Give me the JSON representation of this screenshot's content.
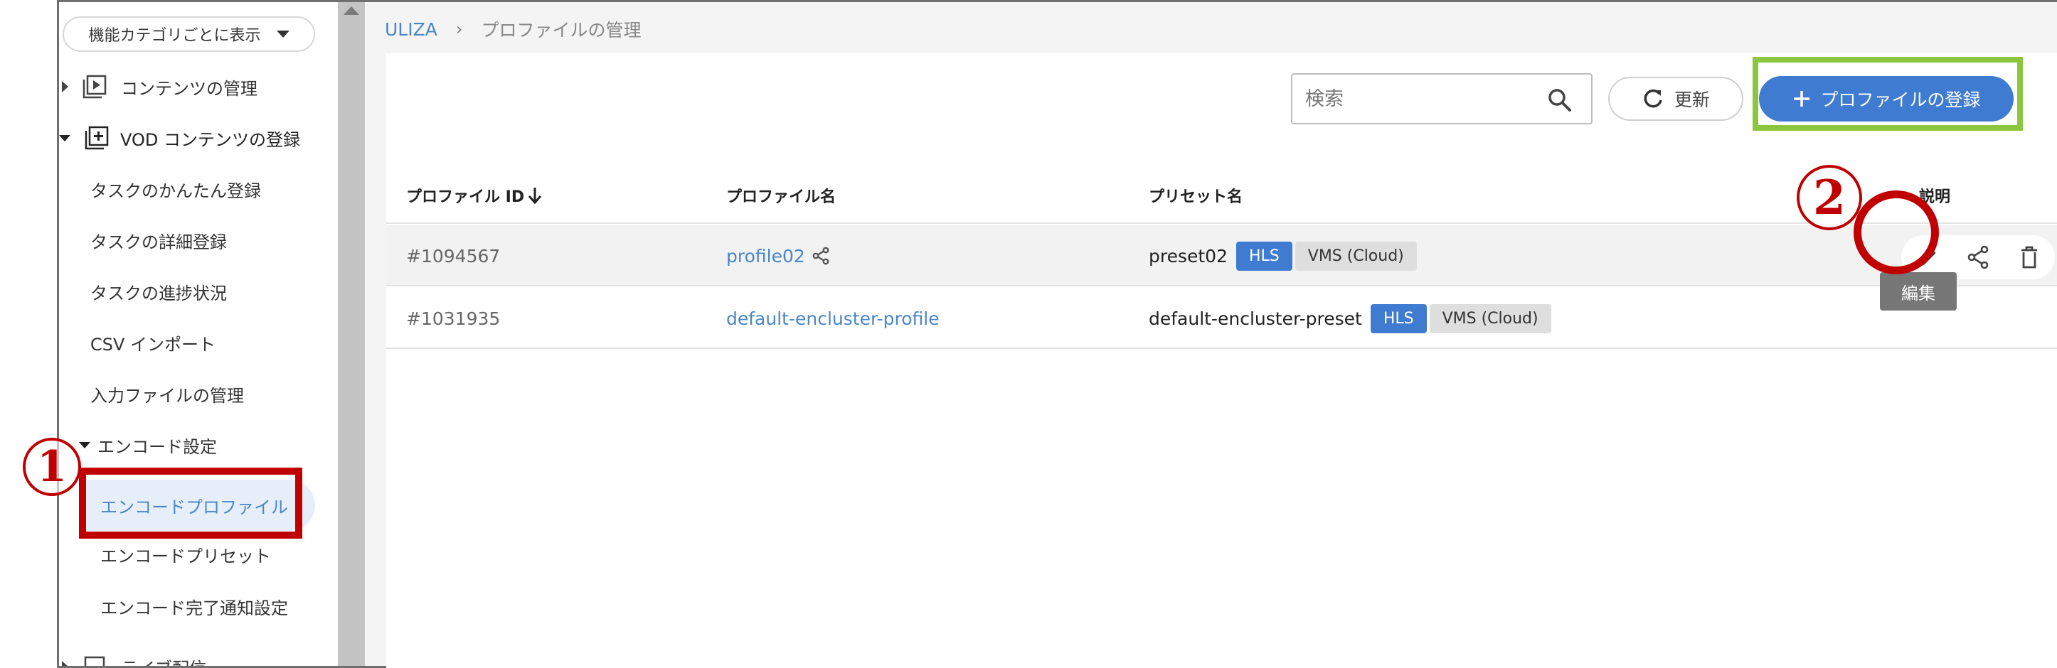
{
  "sidebar": {
    "category_select": "機能カテゴリごとに表示",
    "items": [
      {
        "label": "コンテンツの管理"
      },
      {
        "label": "VOD コンテンツの登録"
      },
      {
        "label": "タスクのかんたん登録"
      },
      {
        "label": "タスクの詳細登録"
      },
      {
        "label": "タスクの進捗状況"
      },
      {
        "label": "CSV インポート"
      },
      {
        "label": "入力ファイルの管理"
      },
      {
        "label": "エンコード設定"
      },
      {
        "label": "エンコードプロファイル"
      },
      {
        "label": "エンコードプリセット"
      },
      {
        "label": "エンコード完了通知設定"
      },
      {
        "label": "ライブ配信"
      }
    ]
  },
  "breadcrumb": {
    "root": "ULIZA",
    "separator": "›",
    "current": "プロファイルの管理"
  },
  "toolbar": {
    "search_placeholder": "検索",
    "refresh_label": "更新",
    "add_label": "プロファイルの登録"
  },
  "table": {
    "columns": [
      "プロファイル ID",
      "プロファイル名",
      "プリセット名",
      "説明"
    ],
    "rows": [
      {
        "id": "#1094567",
        "name": "profile02",
        "preset": "preset02",
        "badge1": "HLS",
        "badge2": "VMS (Cloud)"
      },
      {
        "id": "#1031935",
        "name": "default-encluster-profile",
        "preset": "default-encluster-preset",
        "badge1": "HLS",
        "badge2": "VMS (Cloud)"
      }
    ]
  },
  "tooltip": "編集",
  "annotations": {
    "step1": "1",
    "step2": "2"
  },
  "colors": {
    "accent": "#3f7bd0",
    "annotation_red": "#c00000",
    "annotation_green": "#8cc63f"
  }
}
